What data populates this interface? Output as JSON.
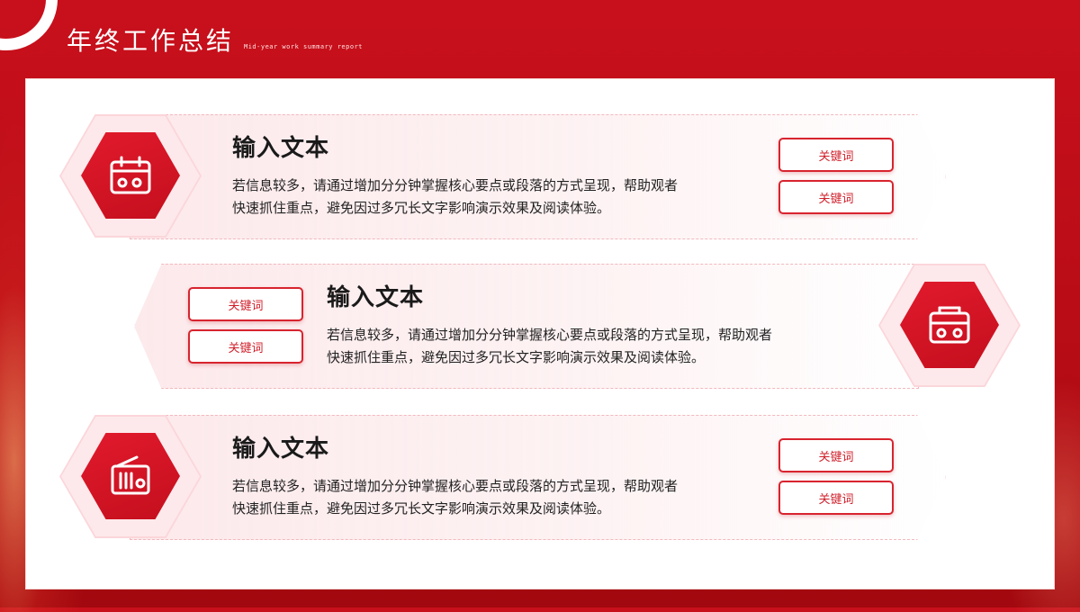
{
  "header": {
    "title": "年终工作总结",
    "subtitle": "Mid-year work summary report"
  },
  "items": [
    {
      "title": "输入文本",
      "desc_line1": "若信息较多，请通过增加分分钟掌握核心要点或段落的方式呈现，帮助观者",
      "desc_line2": "快速抓住重点，避免因过多冗长文字影响演示效果及阅读体验。",
      "keywords": [
        "关键词",
        "关键词"
      ],
      "icon": "calendar-icon"
    },
    {
      "title": "输入文本",
      "desc_line1": "若信息较多，请通过增加分分钟掌握核心要点或段落的方式呈现，帮助观者",
      "desc_line2": "快速抓住重点，避免因过多冗长文字影响演示效果及阅读体验。",
      "keywords": [
        "关键词",
        "关键词"
      ],
      "icon": "radio-icon"
    },
    {
      "title": "输入文本",
      "desc_line1": "若信息较多，请通过增加分分钟掌握核心要点或段落的方式呈现，帮助观者",
      "desc_line2": "快速抓住重点，避免因过多冗长文字影响演示效果及阅读体验。",
      "keywords": [
        "关键词",
        "关键词"
      ],
      "icon": "flag-icon"
    }
  ],
  "colors": {
    "accent": "#d0202b",
    "background": "#c8101c",
    "band": "#fce8ea"
  }
}
